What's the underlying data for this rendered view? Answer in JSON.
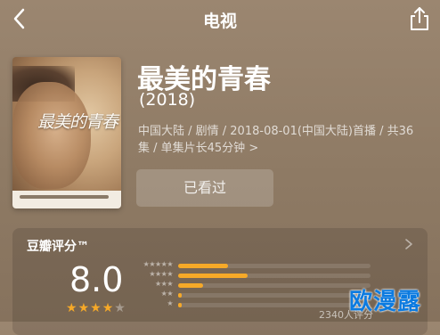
{
  "header": {
    "title": "电视",
    "back_icon": "chevron-left-icon",
    "share_icon": "share-icon"
  },
  "movie": {
    "title": "最美的青春",
    "year": "(2018)",
    "meta_line1": "中国大陆 / 剧情 / 2018-08-01(中国大陆)首播 / 共36",
    "meta_line2": "集 / 单集片长45分钟 >",
    "poster_text": "最美的青春",
    "watched_label": "已看过"
  },
  "rating": {
    "label": "豆瓣评分™",
    "score": "8.0",
    "stars_filled": 4,
    "stars_total": 5,
    "count_label": "2340人评分",
    "distribution": [
      {
        "stars": "★★★★★",
        "percent": 26
      },
      {
        "stars": "★★★★",
        "percent": 36
      },
      {
        "stars": "★★★",
        "percent": 13
      },
      {
        "stars": "★★",
        "percent": 2
      },
      {
        "stars": "★",
        "percent": 2
      }
    ],
    "accent_color": "#f6a928"
  },
  "watermark": "欧漫露"
}
